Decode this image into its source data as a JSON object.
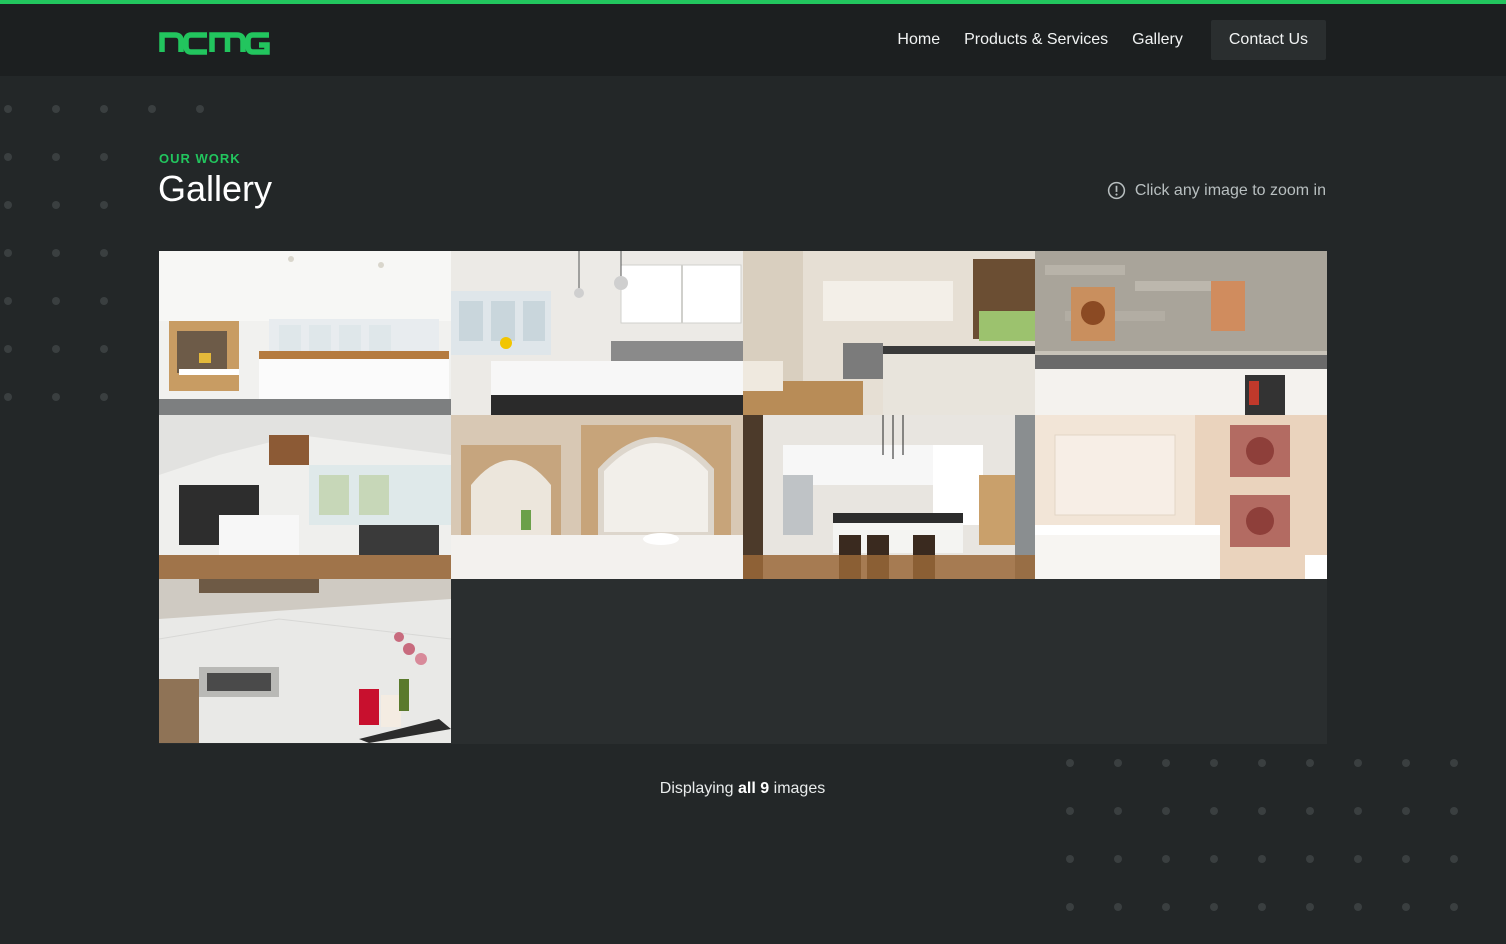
{
  "brand": {
    "logo_text": "ncmg",
    "accent_color": "#22c55e",
    "background_color": "#232728",
    "header_color": "#1c1f20"
  },
  "nav": {
    "items": [
      {
        "label": "Home"
      },
      {
        "label": "Products & Services"
      },
      {
        "label": "Gallery"
      }
    ],
    "contact_label": "Contact Us"
  },
  "section": {
    "eyebrow": "OUR WORK",
    "title": "Gallery",
    "hint": "Click any image to zoom in",
    "hint_icon": "info-circle-icon"
  },
  "gallery": {
    "images": [
      {
        "subject": "white-kitchen-wood-counter",
        "icon": "image-icon"
      },
      {
        "subject": "white-kitchen-island-pendants",
        "icon": "image-icon"
      },
      {
        "subject": "galley-kitchen-window",
        "icon": "image-icon"
      },
      {
        "subject": "kitchen-stone-backsplash",
        "icon": "image-icon"
      },
      {
        "subject": "open-plan-kitchen-dining",
        "icon": "image-icon"
      },
      {
        "subject": "bathroom-arched-mirror",
        "icon": "image-icon"
      },
      {
        "subject": "kitchen-island-stools",
        "icon": "image-icon"
      },
      {
        "subject": "bathroom-vanity-art",
        "icon": "image-icon"
      },
      {
        "subject": "marble-kitchen-orchid",
        "icon": "image-icon"
      }
    ]
  },
  "footer": {
    "prefix": "Displaying ",
    "all_word": "all",
    "count": "9",
    "suffix": " images"
  }
}
